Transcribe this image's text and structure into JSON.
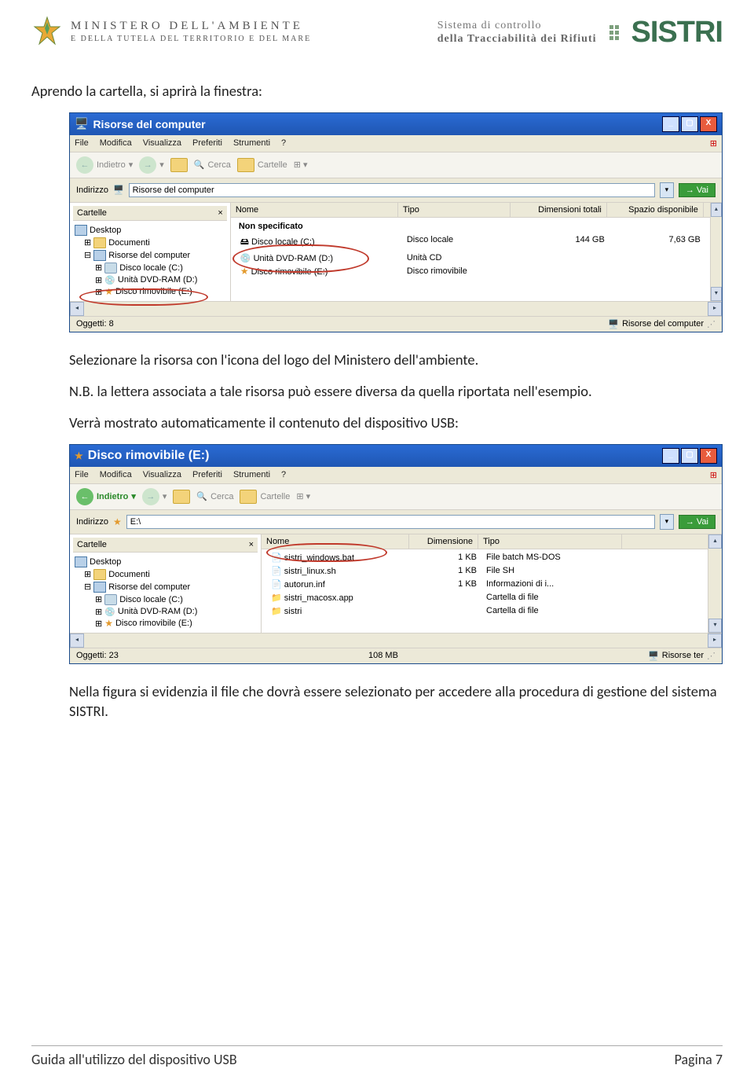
{
  "header": {
    "ministry_line1": "MINISTERO DELL'AMBIENTE",
    "ministry_line2": "E DELLA TUTELA DEL TERRITORIO E DEL MARE",
    "sistri_tag1": "Sistema di controllo",
    "sistri_tag2": "della Tracciabilità dei Rifiuti",
    "sistri_logo": "SISTRI"
  },
  "text": {
    "p1": "Aprendo la cartella, si aprirà la finestra:",
    "p2": "Selezionare la risorsa con l'icona del logo del Ministero dell'ambiente.",
    "p3": "N.B. la lettera associata a tale risorsa può essere diversa da quella riportata nell'esempio.",
    "p4": "Verrà mostrato automaticamente il contenuto del dispositivo USB:",
    "p5": "Nella figura si evidenzia il file che dovrà essere selezionato per accedere alla procedura di gestione del sistema SISTRI."
  },
  "win_common": {
    "menu": [
      "File",
      "Modifica",
      "Visualizza",
      "Preferiti",
      "Strumenti",
      "?"
    ],
    "back": "Indietro",
    "search": "Cerca",
    "folders": "Cartelle",
    "addr_label": "Indirizzo",
    "go": "Vai",
    "tree_header": "Cartelle",
    "close_x": "×"
  },
  "win1": {
    "title": "Risorse del computer",
    "addr_value": "Risorse del computer",
    "tree": {
      "desktop": "Desktop",
      "documenti": "Documenti",
      "risorse": "Risorse del computer",
      "disco_c": "Disco locale (C:)",
      "dvd_d": "Unità DVD-RAM (D:)",
      "rimov_e": "Disco rimovibile (E:)"
    },
    "cols": {
      "nome": "Nome",
      "tipo": "Tipo",
      "dim": "Dimensioni totali",
      "spazio": "Spazio disponibile"
    },
    "group": "Non specificato",
    "rows": [
      {
        "nome": "Disco locale (C:)",
        "tipo": "Disco locale",
        "dim": "144 GB",
        "spazio": "7,63 GB"
      },
      {
        "nome": "Unità DVD-RAM (D:)",
        "tipo": "Unità CD",
        "dim": "",
        "spazio": ""
      },
      {
        "nome": "Disco rimovibile (E:)",
        "tipo": "Disco rimovibile",
        "dim": "",
        "spazio": ""
      }
    ],
    "status_left": "Oggetti: 8",
    "status_right": "Risorse del computer"
  },
  "win2": {
    "title": "Disco rimovibile (E:)",
    "addr_value": "E:\\",
    "tree": {
      "desktop": "Desktop",
      "documenti": "Documenti",
      "risorse": "Risorse del computer",
      "disco_c": "Disco locale (C:)",
      "dvd_d": "Unità DVD-RAM (D:)",
      "rimov_e": "Disco rimovibile (E:)"
    },
    "cols": {
      "nome": "Nome",
      "dim": "Dimensione",
      "tipo": "Tipo"
    },
    "rows": [
      {
        "nome": "sistri_windows.bat",
        "dim": "1 KB",
        "tipo": "File batch MS-DOS"
      },
      {
        "nome": "sistri_linux.sh",
        "dim": "1 KB",
        "tipo": "File SH"
      },
      {
        "nome": "autorun.inf",
        "dim": "1 KB",
        "tipo": "Informazioni di i..."
      },
      {
        "nome": "sistri_macosx.app",
        "dim": "",
        "tipo": "Cartella di file"
      },
      {
        "nome": "sistri",
        "dim": "",
        "tipo": "Cartella di file"
      }
    ],
    "status_left": "Oggetti: 23",
    "status_mid": "108 MB",
    "status_right": "Risorse ter"
  },
  "footer": {
    "left": "Guida all'utilizzo del dispositivo USB",
    "right": "Pagina 7"
  }
}
